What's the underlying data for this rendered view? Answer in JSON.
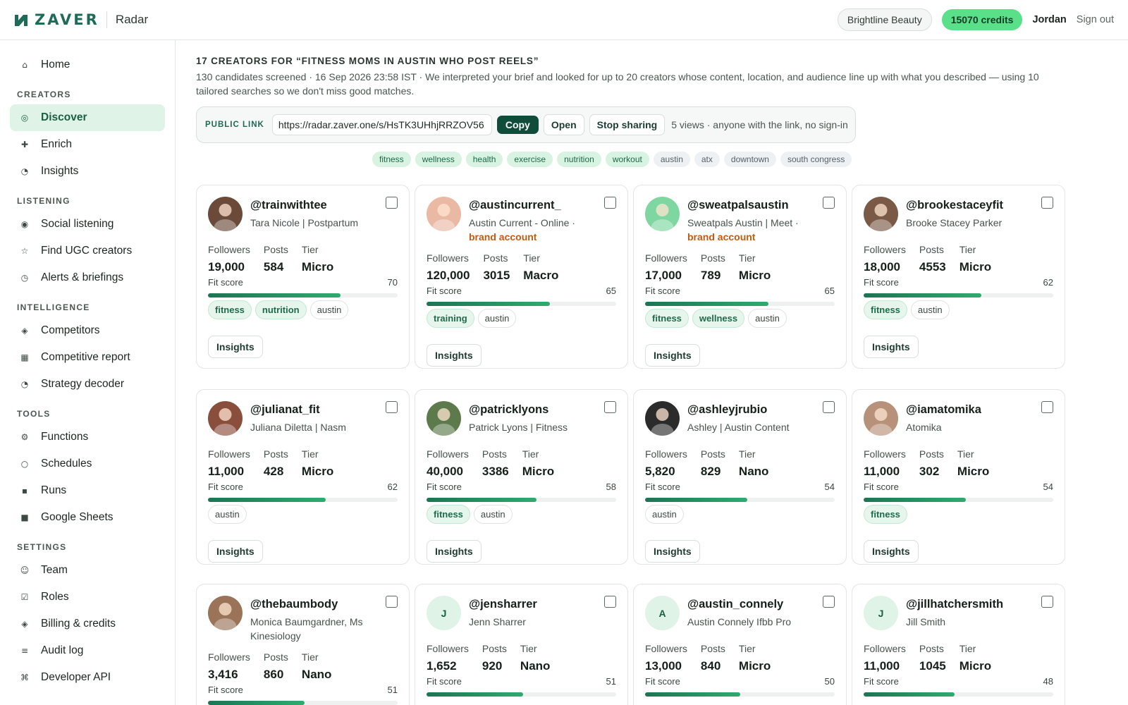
{
  "header": {
    "logo_text": "ZAVER",
    "product": "Radar",
    "org": "Brightline Beauty",
    "credits": "15070 credits",
    "user": "Jordan",
    "signout": "Sign out",
    "brand_color": "#1e6b57"
  },
  "sidebar": {
    "home": "Home",
    "sections": [
      {
        "title": "CREATORS",
        "items": [
          {
            "label": "Discover",
            "icon": "target-icon",
            "active": true
          },
          {
            "label": "Enrich",
            "icon": "plus-icon"
          },
          {
            "label": "Insights",
            "icon": "pie-icon"
          }
        ]
      },
      {
        "title": "LISTENING",
        "items": [
          {
            "label": "Social listening",
            "icon": "radio-icon"
          },
          {
            "label": "Find UGC creators",
            "icon": "star-icon"
          },
          {
            "label": "Alerts & briefings",
            "icon": "clock-icon"
          }
        ]
      },
      {
        "title": "INTELLIGENCE",
        "items": [
          {
            "label": "Competitors",
            "icon": "diamond-icon"
          },
          {
            "label": "Competitive report",
            "icon": "report-icon"
          },
          {
            "label": "Strategy decoder",
            "icon": "pie-icon"
          }
        ]
      },
      {
        "title": "TOOLS",
        "items": [
          {
            "label": "Functions",
            "icon": "gear-icon"
          },
          {
            "label": "Schedules",
            "icon": "circle-icon"
          },
          {
            "label": "Runs",
            "icon": "square-icon"
          },
          {
            "label": "Google Sheets",
            "icon": "sheet-icon"
          }
        ]
      },
      {
        "title": "SETTINGS",
        "items": [
          {
            "label": "Team",
            "icon": "smile-icon"
          },
          {
            "label": "Roles",
            "icon": "checkbox-icon"
          },
          {
            "label": "Billing & credits",
            "icon": "diamond-icon"
          },
          {
            "label": "Audit log",
            "icon": "lines-icon"
          },
          {
            "label": "Developer API",
            "icon": "command-icon"
          }
        ]
      }
    ]
  },
  "results": {
    "title": "17 CREATORS FOR “FITNESS MOMS IN AUSTIN WHO POST REELS”",
    "meta": "130 candidates screened · 16 Sep 2026 23:58 IST · We interpreted your brief and looked for up to 20 creators whose content, location, and audience line up with what you described — using 10 tailored searches so we don't miss good matches.",
    "share": {
      "label": "PUBLIC LINK",
      "url": "https://radar.zaver.one/s/HsTK3UHhjRRZOV56",
      "copy": "Copy",
      "open": "Open",
      "stop": "Stop sharing",
      "stats": "5 views · anyone with the link, no sign-in"
    },
    "chips": [
      {
        "text": "fitness",
        "style": "green"
      },
      {
        "text": "wellness",
        "style": "green"
      },
      {
        "text": "health",
        "style": "green"
      },
      {
        "text": "exercise",
        "style": "green"
      },
      {
        "text": "nutrition",
        "style": "green"
      },
      {
        "text": "workout",
        "style": "green"
      },
      {
        "text": "austin",
        "style": "gray"
      },
      {
        "text": "atx",
        "style": "gray"
      },
      {
        "text": "downtown",
        "style": "gray"
      },
      {
        "text": "south congress",
        "style": "gray"
      }
    ]
  },
  "labels": {
    "followers": "Followers",
    "posts": "Posts",
    "tier": "Tier",
    "fit_score": "Fit score",
    "insights": "Insights"
  },
  "creators": [
    {
      "handle": "@trainwithtee",
      "sub": "Tara Nicole | Postpartum",
      "brand": "",
      "followers": "19,000",
      "posts": "584",
      "tier": "Micro",
      "fit": 70,
      "tags": [
        [
          "fitness",
          "green"
        ],
        [
          "nutrition",
          "green"
        ],
        [
          "austin",
          "plain"
        ]
      ],
      "avatar": "photo",
      "avatar_color": "#6b4a3a"
    },
    {
      "handle": "@austincurrent_",
      "sub": "Austin Current - Online ·",
      "brand": "brand account",
      "followers": "120,000",
      "posts": "3015",
      "tier": "Macro",
      "fit": 65,
      "tags": [
        [
          "training",
          "green"
        ],
        [
          "austin",
          "plain"
        ]
      ],
      "avatar": "photo",
      "avatar_color": "#e9b9a4"
    },
    {
      "handle": "@sweatpalsaustin",
      "sub": "Sweatpals Austin | Meet ·",
      "brand": "brand account",
      "followers": "17,000",
      "posts": "789",
      "tier": "Micro",
      "fit": 65,
      "tags": [
        [
          "fitness",
          "green"
        ],
        [
          "wellness",
          "green"
        ],
        [
          "austin",
          "plain"
        ]
      ],
      "avatar": "photo",
      "avatar_color": "#7ed6a0"
    },
    {
      "handle": "@brookestaceyfit",
      "sub": "Brooke Stacey Parker",
      "brand": "",
      "followers": "18,000",
      "posts": "4553",
      "tier": "Micro",
      "fit": 62,
      "tags": [
        [
          "fitness",
          "green"
        ],
        [
          "austin",
          "plain"
        ]
      ],
      "avatar": "photo",
      "avatar_color": "#7a5a46"
    },
    {
      "handle": "@julianat_fit",
      "sub": "Juliana Diletta | Nasm",
      "brand": "",
      "followers": "11,000",
      "posts": "428",
      "tier": "Micro",
      "fit": 62,
      "tags": [
        [
          "austin",
          "plain"
        ]
      ],
      "avatar": "photo",
      "avatar_color": "#8a4e3c"
    },
    {
      "handle": "@patricklyons",
      "sub": "Patrick Lyons | Fitness",
      "brand": "",
      "followers": "40,000",
      "posts": "3386",
      "tier": "Micro",
      "fit": 58,
      "tags": [
        [
          "fitness",
          "green"
        ],
        [
          "austin",
          "plain"
        ]
      ],
      "avatar": "photo",
      "avatar_color": "#5d7a4c"
    },
    {
      "handle": "@ashleyjrubio",
      "sub": "Ashley | Austin Content",
      "brand": "",
      "followers": "5,820",
      "posts": "829",
      "tier": "Nano",
      "fit": 54,
      "tags": [
        [
          "austin",
          "plain"
        ]
      ],
      "avatar": "photo",
      "avatar_color": "#2b2b2b"
    },
    {
      "handle": "@iamatomika",
      "sub": "Atomika",
      "brand": "",
      "followers": "11,000",
      "posts": "302",
      "tier": "Micro",
      "fit": 54,
      "tags": [
        [
          "fitness",
          "green"
        ]
      ],
      "avatar": "photo",
      "avatar_color": "#b8917a"
    },
    {
      "handle": "@thebaumbody",
      "sub": "Monica Baumgardner, Ms Kinesiology",
      "brand": "",
      "followers": "3,416",
      "posts": "860",
      "tier": "Nano",
      "fit": 51,
      "tags": [],
      "avatar": "photo",
      "avatar_color": "#9a7358"
    },
    {
      "handle": "@jensharrer",
      "sub": "Jenn Sharrer",
      "brand": "",
      "followers": "1,652",
      "posts": "920",
      "tier": "Nano",
      "fit": 51,
      "tags": [],
      "avatar": "J",
      "avatar_color": ""
    },
    {
      "handle": "@austin_connely",
      "sub": "Austin Connely Ifbb Pro",
      "brand": "",
      "followers": "13,000",
      "posts": "840",
      "tier": "Micro",
      "fit": 50,
      "tags": [],
      "avatar": "A",
      "avatar_color": ""
    },
    {
      "handle": "@jillhatchersmith",
      "sub": "Jill Smith",
      "brand": "",
      "followers": "11,000",
      "posts": "1045",
      "tier": "Micro",
      "fit": 48,
      "tags": [],
      "avatar": "J",
      "avatar_color": ""
    }
  ]
}
